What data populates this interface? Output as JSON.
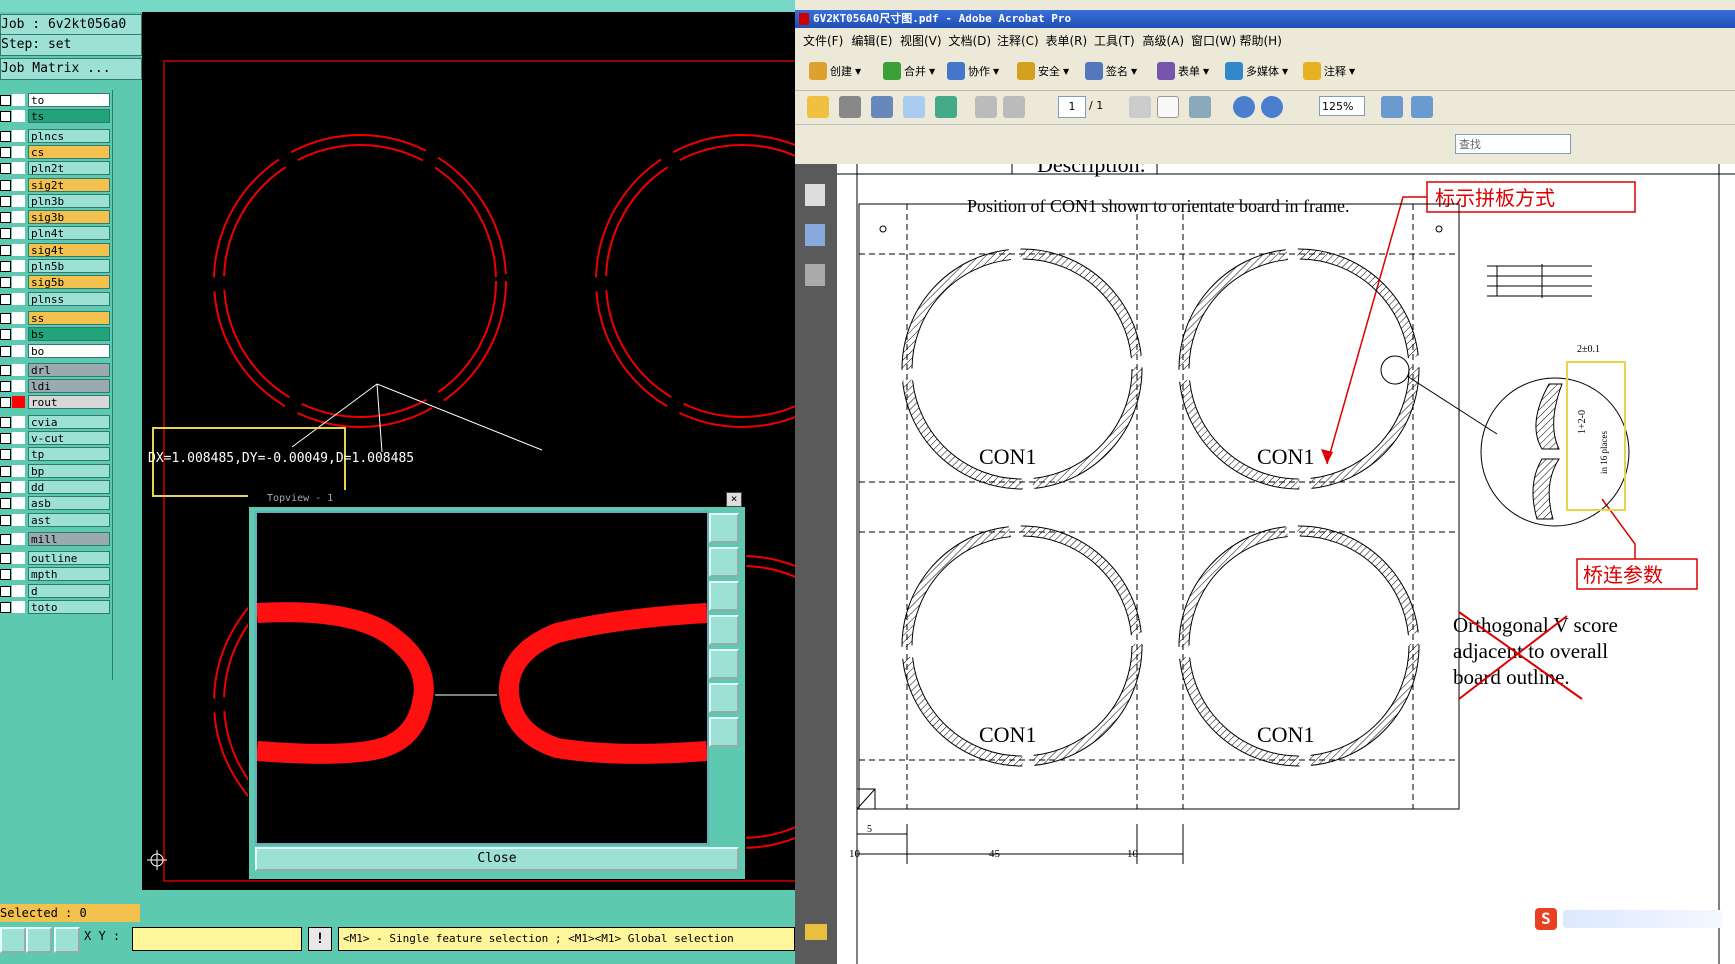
{
  "cam": {
    "job_label": "Job : 6v2kt056a0",
    "step_label": "Step: set",
    "job_matrix": "Job Matrix ...",
    "layers": [
      {
        "name": "to",
        "color": "#ffffff",
        "swatch": "#ffffff"
      },
      {
        "name": "ts",
        "color": "#22a37a",
        "swatch": "#ffffff"
      },
      {
        "name": "plncs",
        "color": "#9de0d6",
        "swatch": "#ffffff"
      },
      {
        "name": "cs",
        "color": "#f2c14e",
        "swatch": "#ffffff"
      },
      {
        "name": "pln2t",
        "color": "#9de0d6",
        "swatch": "#ffffff"
      },
      {
        "name": "sig2t",
        "color": "#f2c14e",
        "swatch": "#ffffff"
      },
      {
        "name": "pln3b",
        "color": "#9de0d6",
        "swatch": "#ffffff"
      },
      {
        "name": "sig3b",
        "color": "#f2c14e",
        "swatch": "#ffffff"
      },
      {
        "name": "pln4t",
        "color": "#9de0d6",
        "swatch": "#ffffff"
      },
      {
        "name": "sig4t",
        "color": "#f2c14e",
        "swatch": "#ffffff"
      },
      {
        "name": "pln5b",
        "color": "#9de0d6",
        "swatch": "#ffffff"
      },
      {
        "name": "sig5b",
        "color": "#f2c14e",
        "swatch": "#ffffff"
      },
      {
        "name": "plnss",
        "color": "#9de0d6",
        "swatch": "#ffffff"
      },
      {
        "name": "ss",
        "color": "#f2c14e",
        "swatch": "#ffffff"
      },
      {
        "name": "bs",
        "color": "#22a37a",
        "swatch": "#ffffff"
      },
      {
        "name": "bo",
        "color": "#ffffff",
        "swatch": "#ffffff"
      },
      {
        "name": "drl",
        "color": "#9aaab0",
        "swatch": "#ffffff"
      },
      {
        "name": "ldi",
        "color": "#9aaab0",
        "swatch": "#ffffff"
      },
      {
        "name": "rout",
        "color": "#d8d8d8",
        "swatch": "#ff0000"
      },
      {
        "name": "cvia",
        "color": "#9de0d6",
        "swatch": "#ffffff"
      },
      {
        "name": "v-cut",
        "color": "#9de0d6",
        "swatch": "#ffffff"
      },
      {
        "name": "tp",
        "color": "#9de0d6",
        "swatch": "#ffffff"
      },
      {
        "name": "bp",
        "color": "#9de0d6",
        "swatch": "#ffffff"
      },
      {
        "name": "dd",
        "color": "#9de0d6",
        "swatch": "#ffffff"
      },
      {
        "name": "asb",
        "color": "#9de0d6",
        "swatch": "#ffffff"
      },
      {
        "name": "ast",
        "color": "#9de0d6",
        "swatch": "#ffffff"
      },
      {
        "name": "mill",
        "color": "#9aaab0",
        "swatch": "#ffffff"
      },
      {
        "name": "outline",
        "color": "#9de0d6",
        "swatch": "#ffffff"
      },
      {
        "name": "mpth",
        "color": "#9de0d6",
        "swatch": "#ffffff"
      },
      {
        "name": "d",
        "color": "#9de0d6",
        "swatch": "#ffffff"
      },
      {
        "name": "toto",
        "color": "#9de0d6",
        "swatch": "#ffffff"
      }
    ],
    "measure_readout": "DX=1.008485,DY=-0.00049,D=1.008485",
    "topview_title": "Topview - 1",
    "topview_close": "Close",
    "selected": "Selected : 0",
    "xy_label": "X Y :",
    "xy_value": "",
    "hint": "<M1> - Single feature selection ; <M1><M1> Global selection",
    "exclaim": "!"
  },
  "acrobat": {
    "title": "6V2KT056A0尺寸图.pdf - Adobe Acrobat Pro",
    "menu": [
      "文件(F)",
      "编辑(E)",
      "视图(V)",
      "文档(D)",
      "注释(C)",
      "表单(R)",
      "工具(T)",
      "高级(A)",
      "窗口(W)",
      "帮助(H)"
    ],
    "toolbar1": [
      {
        "label": "创建",
        "icon": "create-icon",
        "color": "#e0a030"
      },
      {
        "label": "合并",
        "icon": "combine-icon",
        "color": "#3aa03a"
      },
      {
        "label": "协作",
        "icon": "collaborate-icon",
        "color": "#4477cc"
      },
      {
        "label": "安全",
        "icon": "lock-icon",
        "color": "#d4a020"
      },
      {
        "label": "签名",
        "icon": "sign-icon",
        "color": "#5577bb"
      },
      {
        "label": "表单",
        "icon": "forms-icon",
        "color": "#7755aa"
      },
      {
        "label": "多媒体",
        "icon": "multimedia-icon",
        "color": "#3388cc"
      },
      {
        "label": "注释",
        "icon": "comment-icon",
        "color": "#e8b020"
      }
    ],
    "page_current": "1",
    "page_total": "/ 1",
    "zoom": "125%",
    "find_placeholder": "查找",
    "doc": {
      "header_partial": "Description:",
      "caption": "Position of CON1 shown to orientate board in frame.",
      "annot_panel": "标示拼板方式",
      "annot_bridge": "桥连参数",
      "con_labels": [
        "CON1",
        "CON1",
        "CON1",
        "CON1"
      ],
      "vscore_text": [
        "Orthogonal V score",
        "adjacent to overall",
        "board outline."
      ],
      "dim_bottom": [
        "5",
        "10",
        "45",
        "10"
      ],
      "dim_detail_a": "2±0.1",
      "dim_detail_b": "1+2-0",
      "dim_detail_c": "in 16 places"
    }
  }
}
